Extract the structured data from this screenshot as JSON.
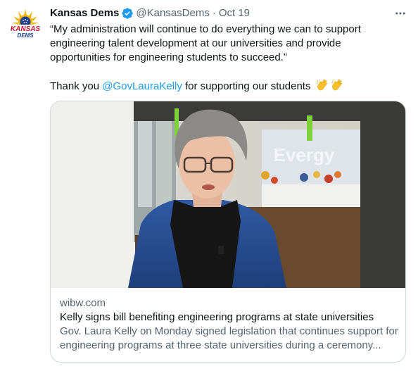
{
  "account": {
    "display_name": "Kansas Dems",
    "handle": "@KansasDems",
    "separator": "·",
    "date": "Oct 19",
    "logo_text_top": "KANSAS",
    "logo_text_bottom": "DEMS"
  },
  "tweet": {
    "quote_lines": [
      "“My administration will continue to do everything we can to support",
      "engineering talent development at our universities and provide",
      "opportunities for engineering students to succeed.”"
    ],
    "thanks_prefix": "Thank you ",
    "mention": "@GovLauraKelly",
    "thanks_suffix": " for supporting our students",
    "emoji_icons": [
      "clapping-hands-icon",
      "clapping-hands-icon"
    ]
  },
  "card": {
    "domain": "wibw.com",
    "title": "Kelly signs bill benefiting engineering programs at state universities",
    "description": "Gov. Laura Kelly on Monday signed legislation that continues support for engineering programs at three state universities during a ceremony...",
    "image_sign_text": "Evergy"
  },
  "colors": {
    "accent": "#1d9bf0",
    "secondary_text": "#536471",
    "border": "#cfd9de",
    "logo_red": "#c8102e",
    "logo_blue": "#1f3f8f",
    "logo_gold": "#f5b400"
  }
}
